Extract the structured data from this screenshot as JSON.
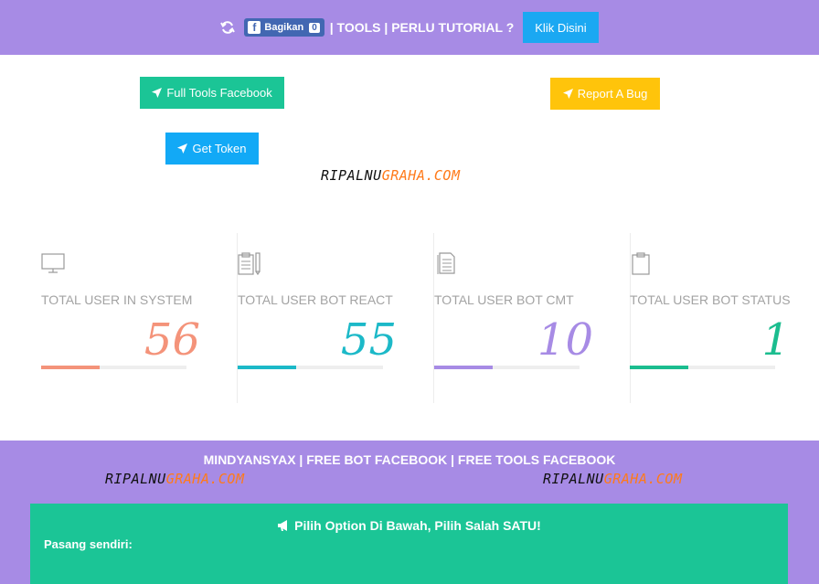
{
  "topbar": {
    "share_label": "Bagikan",
    "share_count": "0",
    "text": "| TOOLS | PERLU TUTORIAL ?",
    "button_label": "Klik Disini"
  },
  "buttons": {
    "full_tools": "Full Tools Facebook",
    "report_bug": "Report A Bug",
    "get_token": "Get Token"
  },
  "brand": {
    "part1": "RIPALNU",
    "part2": "GRAHA.COM"
  },
  "stats": [
    {
      "label": "TOTAL USER IN SYSTEM",
      "value": "56",
      "icon": "monitor-icon",
      "color": "#f4937a",
      "progress": 0.4
    },
    {
      "label": "TOTAL USER BOT REACT",
      "value": "55",
      "icon": "clipboard-pencil-icon",
      "color": "#1cb9c8",
      "progress": 0.4
    },
    {
      "label": "TOTAL USER BOT CMT",
      "value": "10",
      "icon": "document-icon",
      "color": "#a78be5",
      "progress": 0.4
    },
    {
      "label": "TOTAL USER BOT STATUS",
      "value": "1",
      "icon": "clipboard-icon",
      "color": "#1bbd8f",
      "progress": 0.4
    }
  ],
  "footer": {
    "title": "MINDYANSYAX | FREE BOT FACEBOOK | FREE TOOLS FACEBOOK",
    "panel_title": "Pilih Option Di Bawah, Pilih Salah SATU!",
    "panel_sub": "Pasang sendiri:"
  },
  "colors": {
    "purple": "#a78be5",
    "green": "#1bc596",
    "yellow": "#ffc40b",
    "blue": "#12a9f6",
    "brand_orange": "#ff7a1a"
  }
}
